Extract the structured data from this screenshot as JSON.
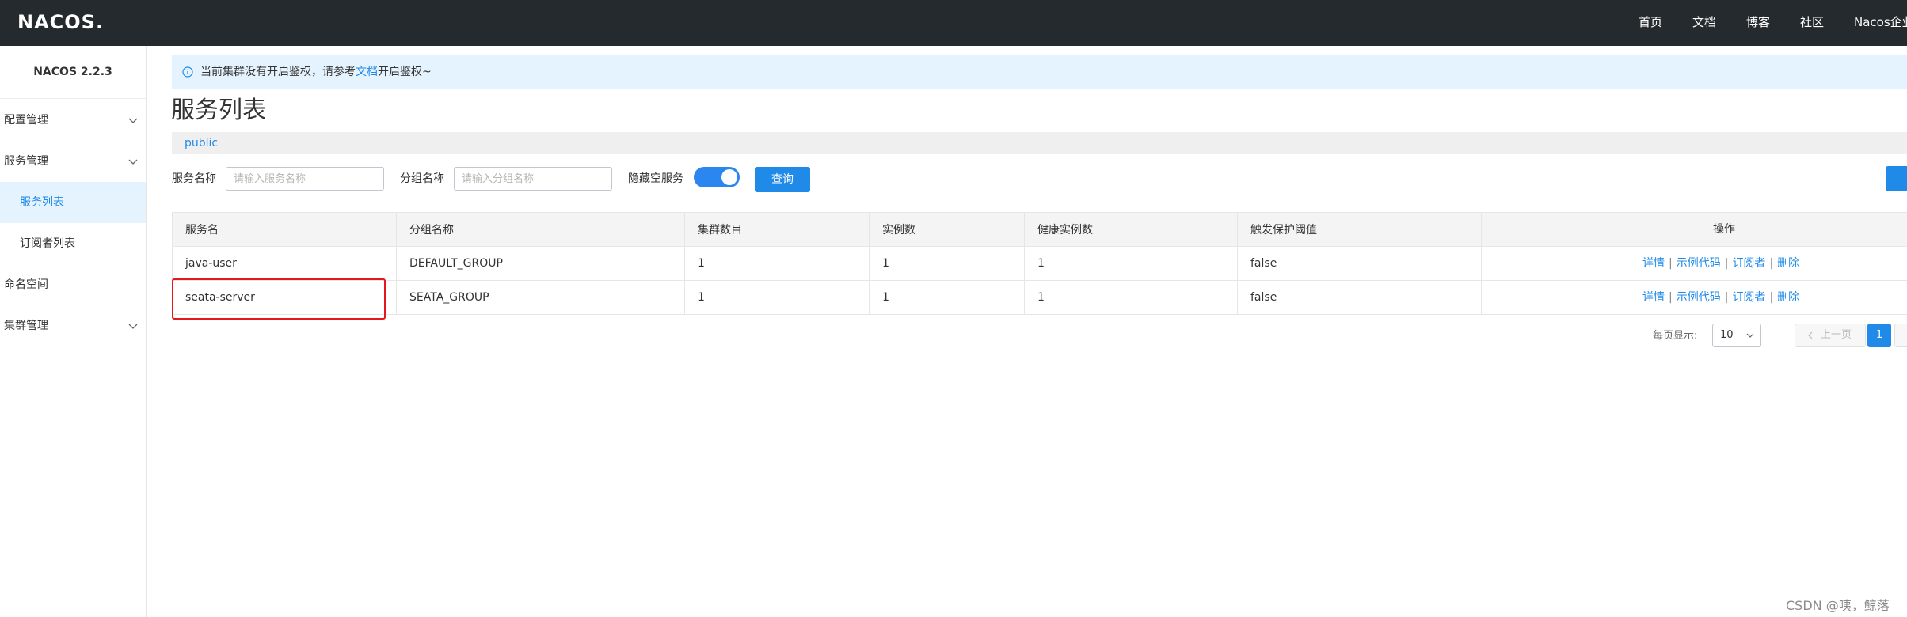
{
  "header": {
    "logo": "NACOS.",
    "nav": [
      "首页",
      "文档",
      "博客",
      "社区",
      "Nacos企业版"
    ]
  },
  "sidebar": {
    "version": "NACOS 2.2.3",
    "items": [
      {
        "label": "配置管理",
        "expandable": true
      },
      {
        "label": "服务管理",
        "expandable": true
      },
      {
        "label": "服务列表",
        "active": true
      },
      {
        "label": "订阅者列表"
      },
      {
        "label": "命名空间"
      },
      {
        "label": "集群管理",
        "expandable": true
      }
    ]
  },
  "notice": {
    "icon": "info-circle-icon",
    "before": "当前集群没有开启鉴权，请参考",
    "link": "文档",
    "after": "开启鉴权~"
  },
  "page": {
    "title": "服务列表",
    "namespace": "public"
  },
  "filters": {
    "service_name_label": "服务名称",
    "service_name_placeholder": "请输入服务名称",
    "group_name_label": "分组名称",
    "group_name_placeholder": "请输入分组名称",
    "hide_empty_label": "隐藏空服务",
    "hide_empty_on": true,
    "query_button": "查询"
  },
  "table": {
    "columns": [
      "服务名",
      "分组名称",
      "集群数目",
      "实例数",
      "健康实例数",
      "触发保护阈值",
      "操作"
    ],
    "rows": [
      {
        "service": "java-user",
        "group": "DEFAULT_GROUP",
        "clusters": "1",
        "instances": "1",
        "healthy": "1",
        "threshold": "false"
      },
      {
        "service": "seata-server",
        "group": "SEATA_GROUP",
        "clusters": "1",
        "instances": "1",
        "healthy": "1",
        "threshold": "false"
      }
    ],
    "actions": [
      "详情",
      "示例代码",
      "订阅者",
      "删除"
    ]
  },
  "pagination": {
    "per_page_label": "每页显示:",
    "per_page_value": "10",
    "prev_label": "上一页",
    "current_page": "1"
  },
  "watermark": "CSDN @咦，鲸落",
  "colors": {
    "topbar": "#252a2f",
    "primary": "#1f8ae8",
    "highlight_box": "#e3171d"
  }
}
